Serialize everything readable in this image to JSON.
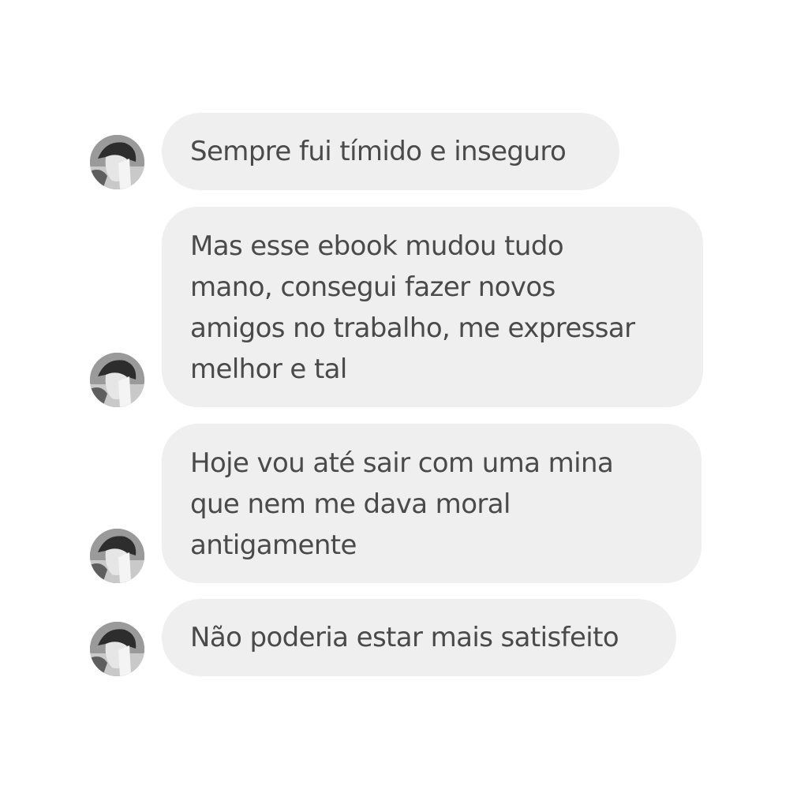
{
  "messages": [
    {
      "text": "Sempre fui tímido e inseguro"
    },
    {
      "text": "Mas esse ebook mudou tudo\nmano, consegui fazer novos\namigos no trabalho, me expressar\nmelhor e tal"
    },
    {
      "text": "Hoje vou até sair com uma mina\nque nem me dava moral\nantigamente"
    },
    {
      "text": "Não poderia estar mais satisfeito"
    }
  ],
  "colors": {
    "bubble_background": "#efefef",
    "text": "#4a4a4a",
    "page_background": "#ffffff"
  },
  "icons": {
    "avatar": "user-avatar-photo-grayscale"
  }
}
